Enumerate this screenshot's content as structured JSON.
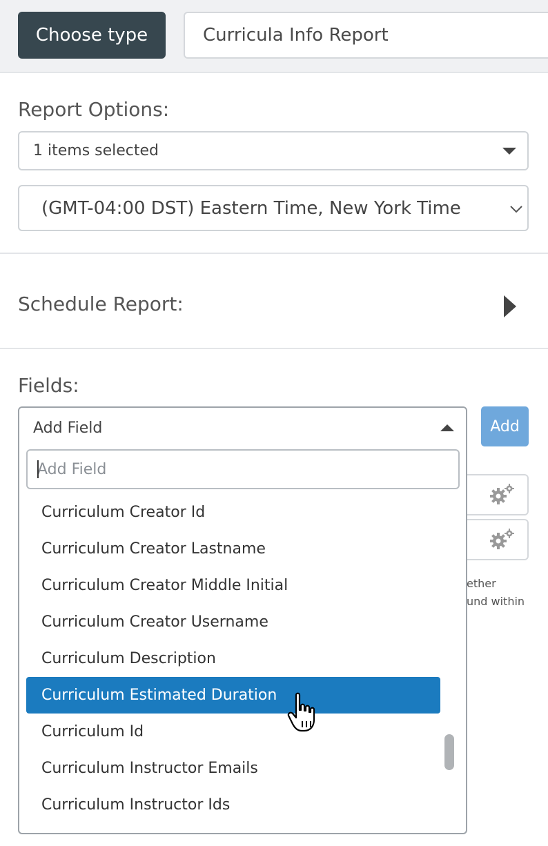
{
  "header": {
    "choose_type_label": "Choose type",
    "report_name_value": "Curricula Info Report"
  },
  "report_options": {
    "title": "Report Options:",
    "selection_value": "1 items selected",
    "timezone_value": "(GMT-04:00 DST) Eastern Time, New York Time"
  },
  "schedule": {
    "title": "Schedule Report:"
  },
  "fields": {
    "title": "Fields:",
    "dropdown_label": "Add Field",
    "search_placeholder": "Add Field",
    "add_button_label": "Add",
    "items": [
      "Curriculum Creator Id",
      "Curriculum Creator Lastname",
      "Curriculum Creator Middle Initial",
      "Curriculum Creator Username",
      "Curriculum Description",
      "Curriculum Estimated Duration",
      "Curriculum Id",
      "Curriculum Instructor Emails",
      "Curriculum Instructor Ids"
    ],
    "highlighted_index": 5,
    "hint_line1": "ether",
    "hint_line2": "und within"
  },
  "icons": {
    "gear": "gear-icon",
    "pointer": "hand-pointer-icon",
    "expand": "play-arrow-icon"
  },
  "colors": {
    "primary_dark": "#37474f",
    "highlight": "#1b7bbf",
    "add_button": "#6fa8dc"
  }
}
